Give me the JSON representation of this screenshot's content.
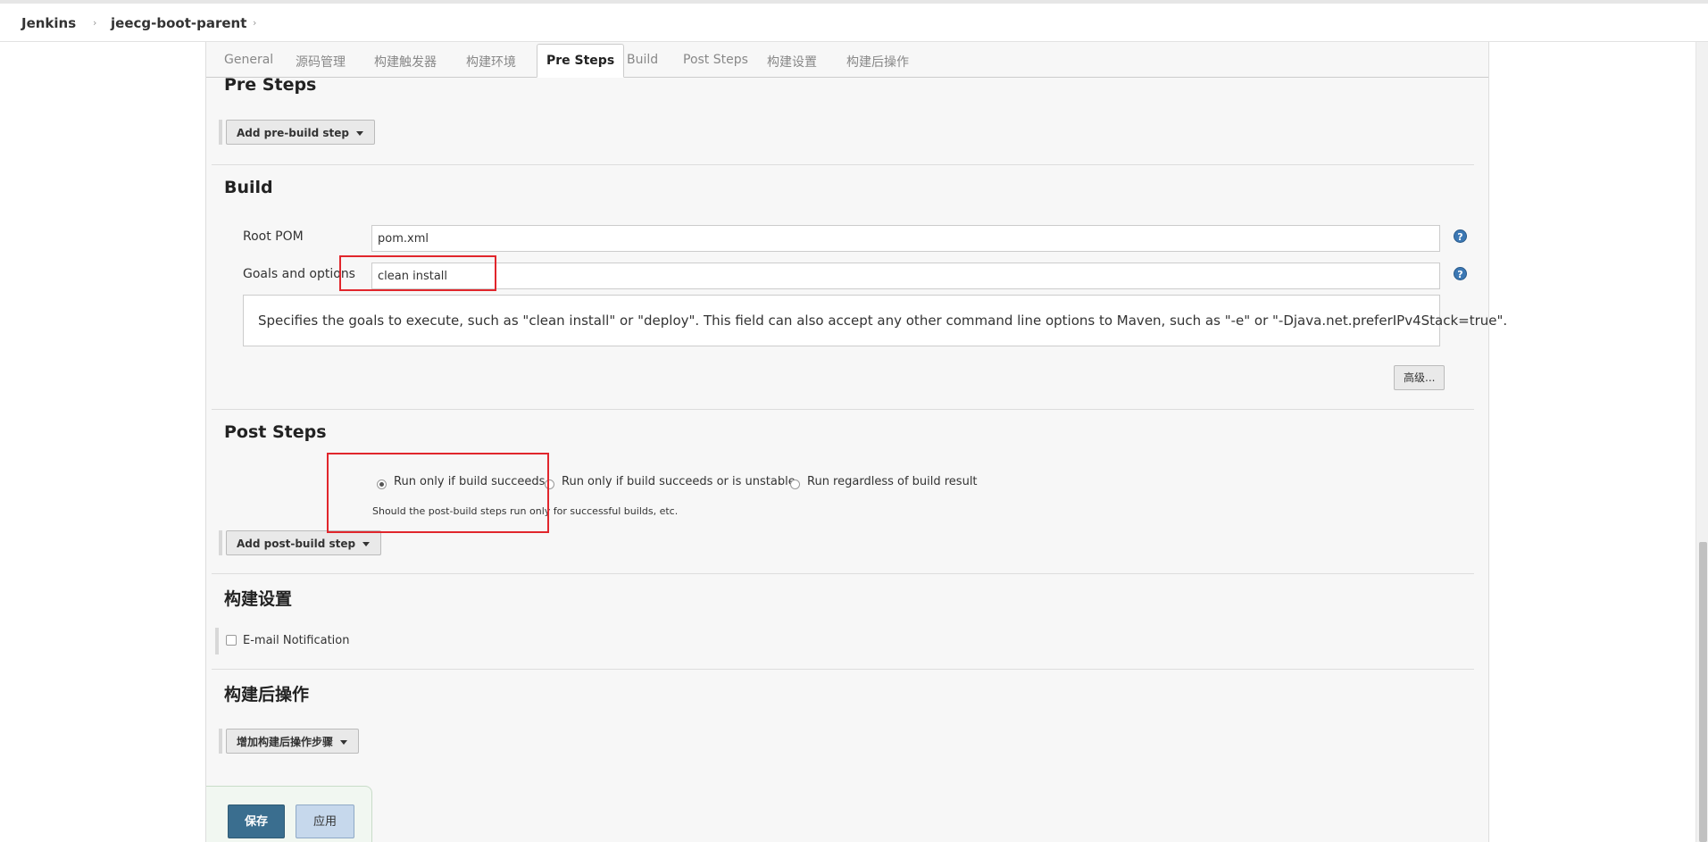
{
  "breadcrumb": {
    "items": [
      "Jenkins",
      "jeecg-boot-parent"
    ]
  },
  "tabs": [
    {
      "label": "General"
    },
    {
      "label": "源码管理"
    },
    {
      "label": "构建触发器"
    },
    {
      "label": "构建环境"
    },
    {
      "label": "Pre Steps",
      "active": true
    },
    {
      "label": "Build"
    },
    {
      "label": "Post Steps"
    },
    {
      "label": "构建设置"
    },
    {
      "label": "构建后操作"
    }
  ],
  "pre_steps": {
    "title": "Pre Steps",
    "add_button": "Add pre-build step"
  },
  "build": {
    "title": "Build",
    "root_pom_label": "Root POM",
    "root_pom_value": "pom.xml",
    "goals_label": "Goals and options",
    "goals_value": "clean install",
    "help_text": "Specifies the goals to execute, such as \"clean install\" or \"deploy\". This field can also accept any other command line options to Maven, such as \"-e\" or \"-Djava.net.preferIPv4Stack=true\".",
    "advanced_button": "高级..."
  },
  "post_steps": {
    "title": "Post Steps",
    "options": [
      {
        "label": "Run only if build succeeds",
        "checked": true
      },
      {
        "label": "Run only if build succeeds or is unstable",
        "checked": false
      },
      {
        "label": "Run regardless of build result",
        "checked": false
      }
    ],
    "note": "Should the post-build steps run only for successful builds, etc.",
    "add_button": "Add post-build step"
  },
  "build_settings": {
    "title": "构建设置",
    "email_label": "E-mail Notification",
    "email_checked": false
  },
  "post_build": {
    "title": "构建后操作",
    "add_button": "增加构建后操作步骤"
  },
  "actions": {
    "save": "保存",
    "apply": "应用"
  },
  "icons": {
    "help": "help-icon",
    "chevron": "chevron-right-icon",
    "caret": "caret-down-icon"
  },
  "colors": {
    "annotation_red": "#e1262c",
    "save_blue": "#3a6e8f",
    "help_blue": "#3c78b4"
  }
}
